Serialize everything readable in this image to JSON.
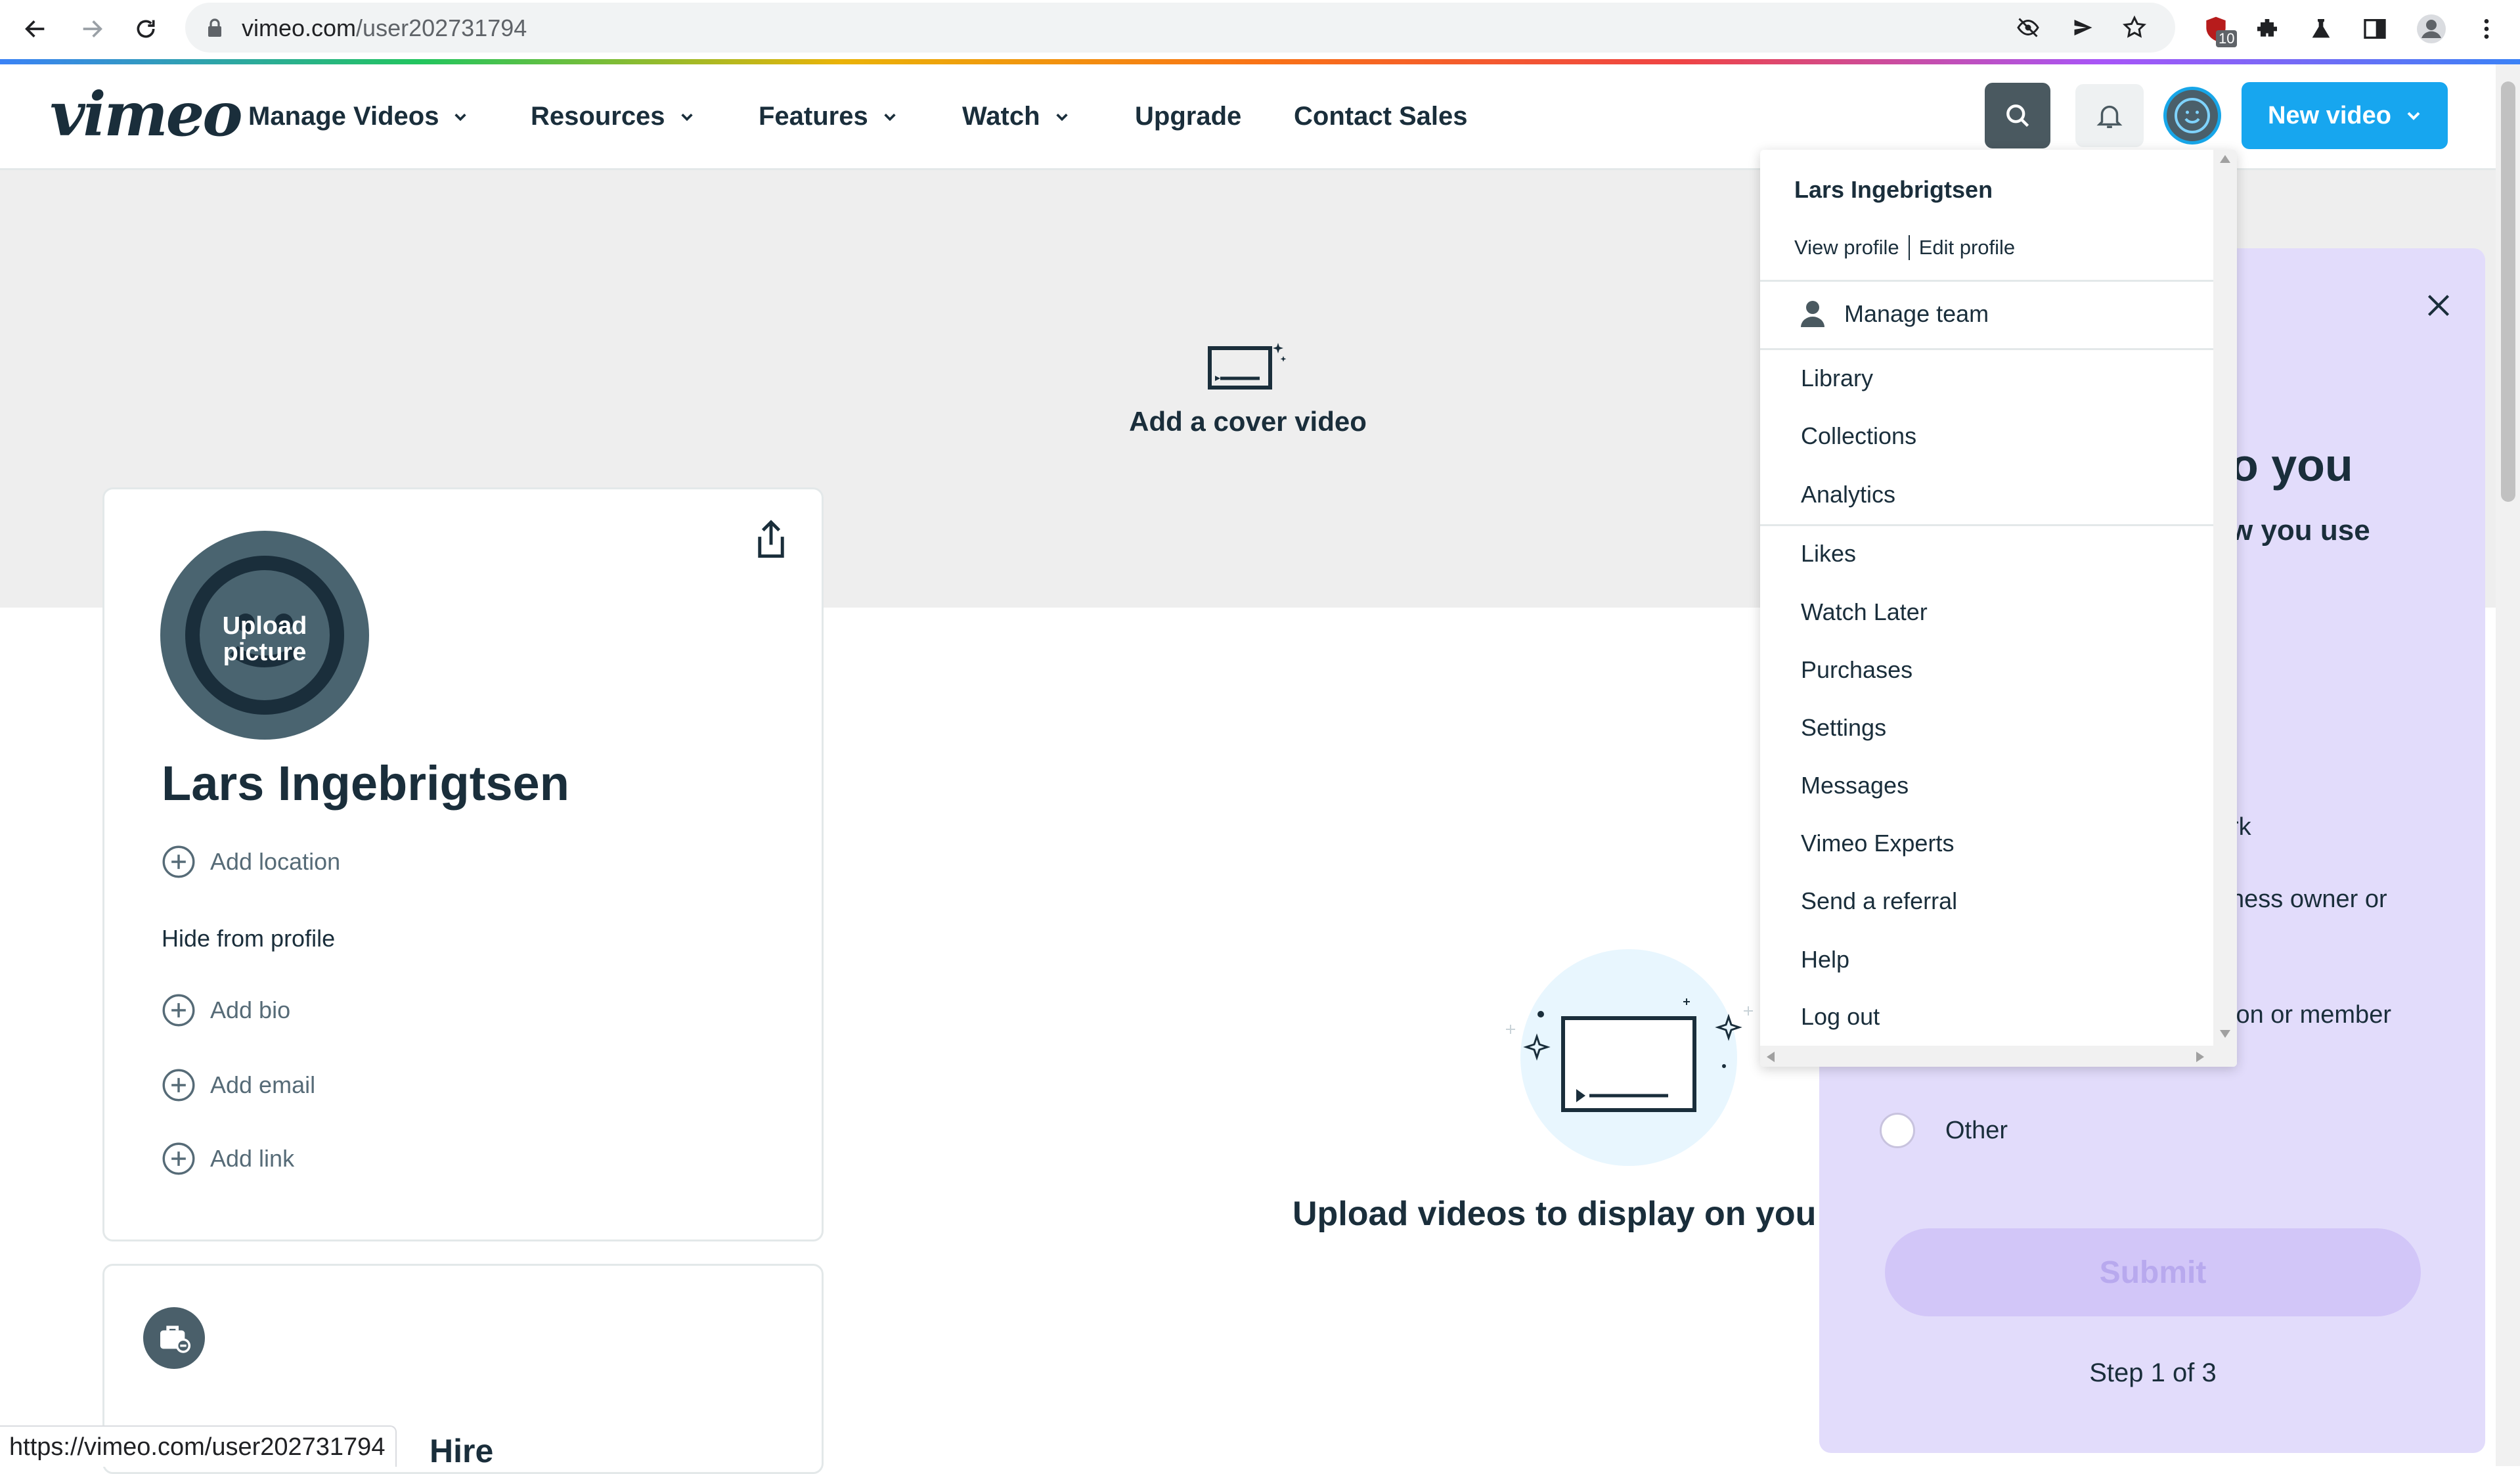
{
  "browser": {
    "url_host": "vimeo.com",
    "url_path": "/user202731794",
    "extension_badge": "10",
    "status_url": "https://vimeo.com/user202731794"
  },
  "header": {
    "logo": "vimeo",
    "nav": [
      {
        "label": "Manage Videos"
      },
      {
        "label": "Resources"
      },
      {
        "label": "Features"
      },
      {
        "label": "Watch"
      },
      {
        "label": "Upgrade"
      },
      {
        "label": "Contact Sales"
      }
    ],
    "new_video_label": "New video"
  },
  "cover": {
    "label": "Add a cover video"
  },
  "profile": {
    "upload_picture_line1": "Upload",
    "upload_picture_line2": "picture",
    "name": "Lars Ingebrigtsen",
    "add_location": "Add location",
    "hide_from_profile": "Hide from profile",
    "add_bio": "Add bio",
    "add_email": "Add email",
    "add_link": "Add link",
    "hire_label": "Hire"
  },
  "empty_state": {
    "text": "Upload videos to display on you"
  },
  "survey": {
    "heading_fragment": "o you",
    "subheading_fragment": "w you use",
    "options": [
      "rk",
      "ness owner or",
      "ion or member",
      "Other"
    ],
    "submit_label": "Submit",
    "step_text": "Step 1 of 3"
  },
  "account_menu": {
    "user_name": "Lars Ingebrigtsen",
    "view_profile": "View profile",
    "edit_profile": "Edit profile",
    "manage_team": "Manage team",
    "items": [
      "Library",
      "Collections",
      "Analytics",
      "Likes",
      "Watch Later",
      "Purchases",
      "Settings",
      "Messages",
      "Vimeo Experts",
      "Send a referral",
      "Help",
      "Log out"
    ]
  },
  "colors": {
    "brand_blue": "#17a6ef",
    "text_dark": "#1a2e3b",
    "survey_bg": "#e2dcfb",
    "submit_disabled": "#d2c6f8",
    "avatar_slate": "#4a6470"
  }
}
